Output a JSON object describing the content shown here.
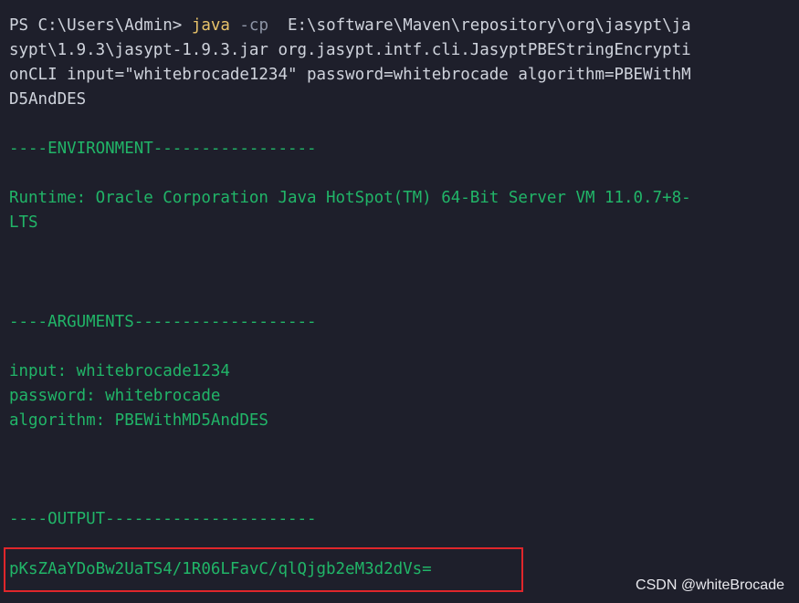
{
  "terminal": {
    "command": {
      "prompt": "PS C:\\Users\\Admin> ",
      "program": "java",
      "flag": " -cp",
      "args_line1": "  E:\\software\\Maven\\repository\\org\\jasypt\\ja",
      "line2": "sypt\\1.9.3\\jasypt-1.9.3.jar org.jasypt.intf.cli.JasyptPBEStringEncrypti",
      "line3": "onCLI input=\"whitebrocade1234\" password=whitebrocade algorithm=PBEWithM",
      "line4": "D5AndDES"
    },
    "environment": {
      "header": "----ENVIRONMENT-----------------",
      "runtime_line1": "Runtime: Oracle Corporation Java HotSpot(TM) 64-Bit Server VM 11.0.7+8-",
      "runtime_line2": "LTS"
    },
    "arguments": {
      "header": "----ARGUMENTS-------------------",
      "input": "input: whitebrocade1234",
      "password": "password: whitebrocade",
      "algorithm": "algorithm: PBEWithMD5AndDES"
    },
    "output": {
      "header": "----OUTPUT----------------------",
      "value": "pKsZAaYDoBw2UaTS4/1R06LFavC/qlQjgb2eM3d2dVs="
    },
    "colors": {
      "background": "#1e1f2b",
      "text": "#21b568",
      "prompt": "#cfd3dc",
      "command": "#e8c36a",
      "flag": "#8e95a6",
      "highlight_border": "#e0262b"
    }
  },
  "watermark": "CSDN @whiteBrocade"
}
